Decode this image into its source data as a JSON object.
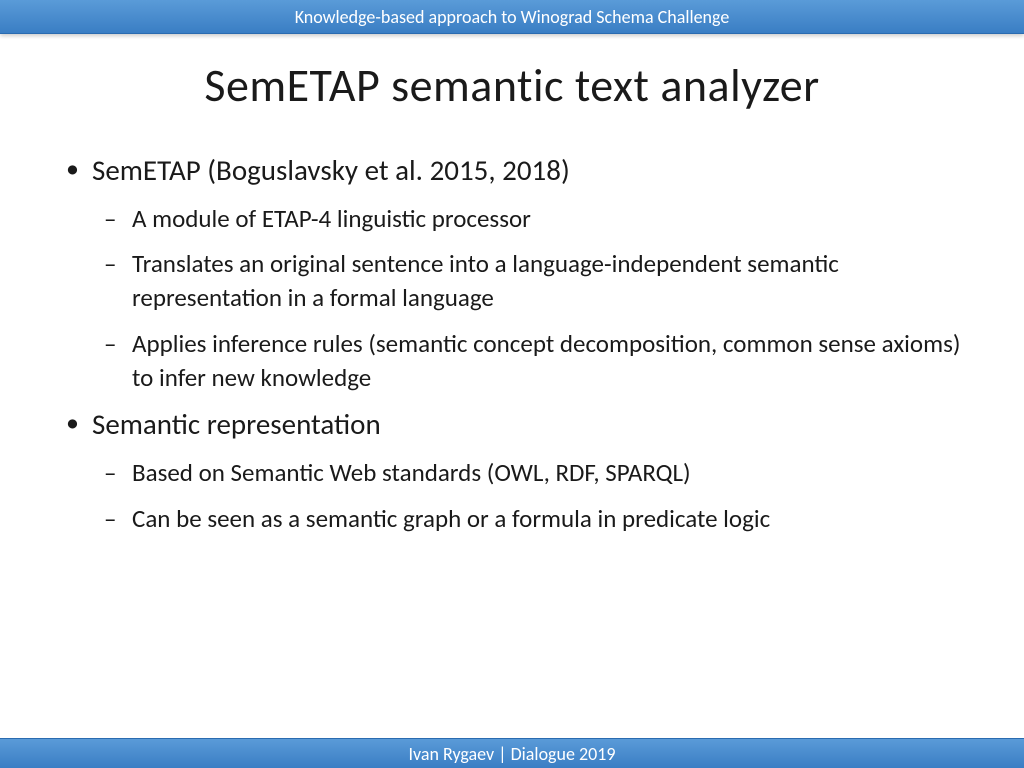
{
  "header": {
    "text": "Knowledge-based approach to Winograd  Schema Challenge"
  },
  "title": "SemETAP semantic text analyzer",
  "bullets": [
    {
      "text": "SemETAP (Boguslavsky et al. 2015, 2018)",
      "sub": [
        "A module of ETAP-4 linguistic processor",
        "Translates an original sentence into a language-independent semantic representation in a formal language",
        "Applies inference rules (semantic concept decomposition, common sense axioms) to infer new knowledge"
      ]
    },
    {
      "text": "Semantic representation",
      "sub": [
        "Based on Semantic Web standards (OWL, RDF, SPARQL)",
        "Can be seen as a semantic graph or a formula in predicate logic"
      ]
    }
  ],
  "footer": {
    "text": "Ivan Rygaev  | Dialogue 2019"
  }
}
